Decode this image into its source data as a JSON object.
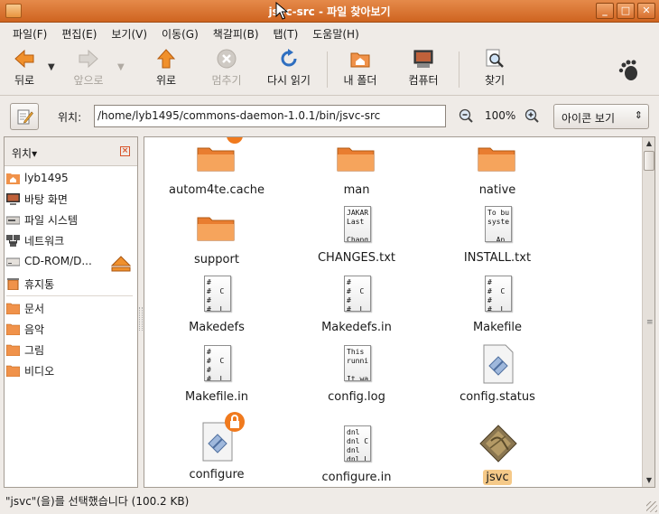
{
  "window": {
    "title": "jsvc-src - 파일 찾아보기",
    "buttons": {
      "minimize": "_",
      "maximize": "□",
      "close": "✕"
    }
  },
  "menu": [
    "파일(F)",
    "편집(E)",
    "보기(V)",
    "이동(G)",
    "책갈피(B)",
    "탭(T)",
    "도움말(H)"
  ],
  "toolbar": {
    "back": "뒤로",
    "forward": "앞으로",
    "up": "위로",
    "stop": "멈추기",
    "reload": "다시 읽기",
    "home": "내 폴더",
    "computer": "컴퓨터",
    "search": "찾기"
  },
  "location": {
    "label": "위치:",
    "path": "/home/lyb1495/commons-daemon-1.0.1/bin/jsvc-src",
    "zoom": "100%",
    "view_mode": "아이콘 보기"
  },
  "sidebar": {
    "header": "위치",
    "items": [
      {
        "label": "lyb1495",
        "icon": "home-folder-icon"
      },
      {
        "label": "바탕 화면",
        "icon": "desktop-icon"
      },
      {
        "label": "파일 시스템",
        "icon": "filesystem-icon"
      },
      {
        "label": "네트워크",
        "icon": "network-icon"
      },
      {
        "label": "CD-ROM/D...",
        "icon": "cdrom-icon"
      },
      {
        "label": "휴지통",
        "icon": "trash-icon"
      },
      {
        "label": "문서",
        "icon": "folder-icon"
      },
      {
        "label": "음악",
        "icon": "folder-icon"
      },
      {
        "label": "그림",
        "icon": "folder-icon"
      },
      {
        "label": "비디오",
        "icon": "folder-icon"
      }
    ]
  },
  "files": [
    {
      "name": "autom4te.cache",
      "kind": "folder",
      "locked": true
    },
    {
      "name": "man",
      "kind": "folder"
    },
    {
      "name": "native",
      "kind": "folder"
    },
    {
      "name": "support",
      "kind": "folder"
    },
    {
      "name": "CHANGES.txt",
      "kind": "text",
      "preview": "JAKAR\nLast\n\nChang"
    },
    {
      "name": "INSTALL.txt",
      "kind": "text",
      "preview": "To bu\nsyste\n\n  An"
    },
    {
      "name": "Makedefs",
      "kind": "text",
      "preview": "#\n#  C\n#\n#  L"
    },
    {
      "name": "Makedefs.in",
      "kind": "text",
      "preview": "#\n#  C\n#\n#  L"
    },
    {
      "name": "Makefile",
      "kind": "text",
      "preview": "#\n#  C\n#\n#  L"
    },
    {
      "name": "Makefile.in",
      "kind": "text",
      "preview": "#\n#  C\n#\n#  L"
    },
    {
      "name": "config.log",
      "kind": "text",
      "preview": "This\nrunni\n\nIt wa"
    },
    {
      "name": "config.status",
      "kind": "script"
    },
    {
      "name": "configure",
      "kind": "script",
      "locked": true
    },
    {
      "name": "configure.in",
      "kind": "text",
      "preview": "dnl\ndnl C\ndnl\ndnl L"
    },
    {
      "name": "jsvc",
      "kind": "executable",
      "selected": true
    }
  ],
  "status": "\"jsvc\"(을)를 선택했습니다 (100.2 KB)",
  "colors": {
    "title_accent": "#d8702e",
    "folder": "#f0924a",
    "selection": "#f5c988"
  }
}
